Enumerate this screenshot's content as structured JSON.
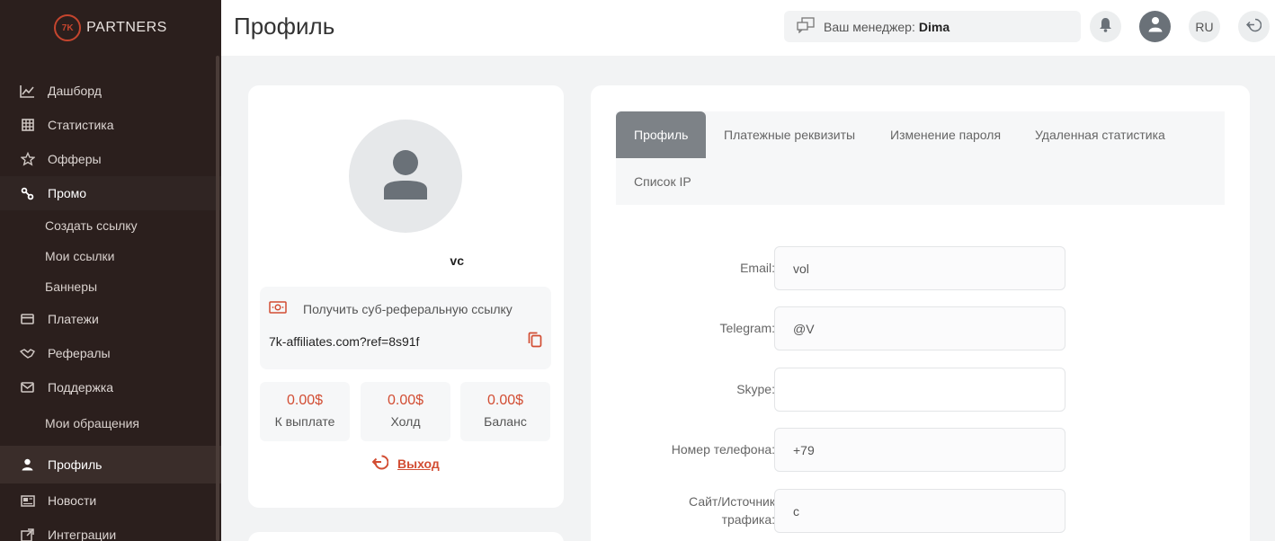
{
  "app": {
    "logo_mark": "7K",
    "logo_text": "PARTNERS",
    "brand_color": "#d24d33"
  },
  "sidebar": {
    "items": [
      {
        "label": "Дашборд",
        "icon": "chart-line-icon"
      },
      {
        "label": "Статистика",
        "icon": "grid-icon"
      },
      {
        "label": "Офферы",
        "icon": "star-icon"
      },
      {
        "label": "Промо",
        "icon": "percent-icon"
      },
      {
        "label": "Создать ссылку"
      },
      {
        "label": "Мои ссылки"
      },
      {
        "label": "Баннеры"
      },
      {
        "label": "Платежи",
        "icon": "card-icon"
      },
      {
        "label": "Рефералы",
        "icon": "handshake-icon"
      },
      {
        "label": "Поддержка",
        "icon": "mail-icon"
      },
      {
        "label": "Мои обращения"
      },
      {
        "label": "Профиль",
        "icon": "user-icon"
      },
      {
        "label": "Новости",
        "icon": "news-icon"
      },
      {
        "label": "Интеграции",
        "icon": "integration-icon"
      }
    ]
  },
  "header": {
    "title": "Профиль",
    "manager_label": "Ваш менеджер:",
    "manager_name": "Dima",
    "lang": "RU"
  },
  "profile": {
    "username": "vc",
    "ref_title": "Получить суб-реферальную ссылку",
    "ref_link": "7k-affiliates.com?ref=8s91f",
    "stats": [
      {
        "value": "0.00$",
        "label": "К выплате"
      },
      {
        "value": "0.00$",
        "label": "Холд"
      },
      {
        "value": "0.00$",
        "label": "Баланс"
      }
    ],
    "logout_label": "Выход"
  },
  "tabs": [
    {
      "label": "Профиль",
      "active": true
    },
    {
      "label": "Платежные реквизиты"
    },
    {
      "label": "Изменение пароля"
    },
    {
      "label": "Удаленная статистика"
    },
    {
      "label": "Список IP"
    }
  ],
  "form": {
    "fields": [
      {
        "label": "Email:",
        "value": "vol"
      },
      {
        "label": "Telegram:",
        "value": "@V"
      },
      {
        "label": "Skype:",
        "value": ""
      },
      {
        "label": "Номер телефона:",
        "value": "+79"
      },
      {
        "label": "Сайт/Источник трафика:",
        "value": "c"
      }
    ]
  }
}
